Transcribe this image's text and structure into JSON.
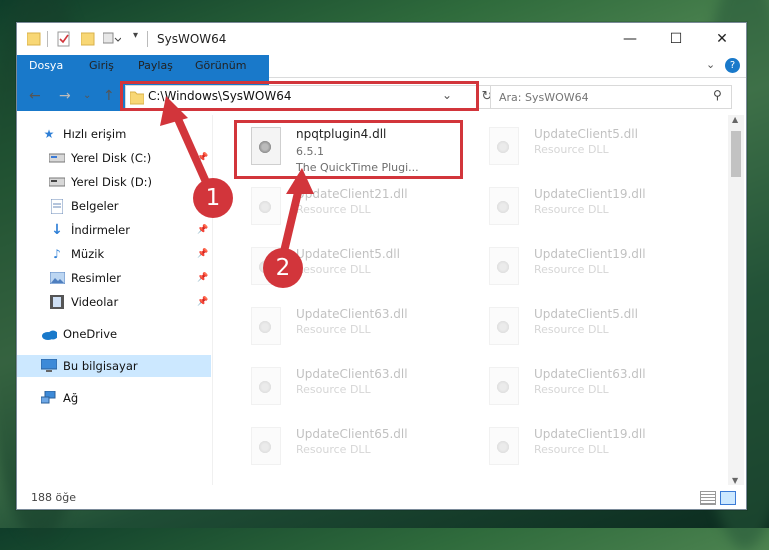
{
  "window": {
    "title": "SysWOW64",
    "minimize": "—",
    "maximize": "☐",
    "close": "✕"
  },
  "ribbon": {
    "tabs": [
      "Dosya",
      "Giriş",
      "Paylaş",
      "Görünüm"
    ],
    "expand_icon": "chevron-down-icon",
    "help": "?"
  },
  "address": {
    "path": "C:\\Windows\\SysWOW64",
    "search_placeholder": "Ara: SysWOW64"
  },
  "sidebar": {
    "items": [
      {
        "label": "Hızlı erişim",
        "icon": "star-icon"
      },
      {
        "label": "Yerel Disk (C:)",
        "icon": "drive-icon"
      },
      {
        "label": "Yerel Disk (D:)",
        "icon": "drive-icon"
      },
      {
        "label": "Belgeler",
        "icon": "document-icon"
      },
      {
        "label": "İndirmeler",
        "icon": "download-icon"
      },
      {
        "label": "Müzik",
        "icon": "music-icon"
      },
      {
        "label": "Resimler",
        "icon": "pictures-icon"
      },
      {
        "label": "Videolar",
        "icon": "video-icon"
      },
      {
        "label": "OneDrive",
        "icon": "cloud-icon"
      },
      {
        "label": "Bu bilgisayar",
        "icon": "computer-icon"
      },
      {
        "label": "Ağ",
        "icon": "network-icon"
      }
    ]
  },
  "files": [
    {
      "name": "npqtplugin4.dll",
      "line1": "6.5.1",
      "line2": "The QuickTime Plugi..."
    },
    {
      "name": "UpdateClient5.dll",
      "line1": "Resource DLL"
    },
    {
      "name": "UpdateClient21.dll",
      "line1": "Resource DLL"
    },
    {
      "name": "UpdateClient19.dll",
      "line1": "Resource DLL"
    },
    {
      "name": "UpdateClient5.dll",
      "line1": "Resource DLL"
    },
    {
      "name": "UpdateClient19.dll",
      "line1": "Resource DLL"
    },
    {
      "name": "UpdateClient63.dll",
      "line1": "Resource DLL"
    },
    {
      "name": "UpdateClient5.dll",
      "line1": "Resource DLL"
    },
    {
      "name": "UpdateClient63.dll",
      "line1": "Resource DLL"
    },
    {
      "name": "UpdateClient63.dll",
      "line1": "Resource DLL"
    },
    {
      "name": "UpdateClient65.dll",
      "line1": "Resource DLL"
    },
    {
      "name": "UpdateClient19.dll",
      "line1": "Resource DLL"
    }
  ],
  "status": {
    "count": "188 öğe"
  },
  "annotations": {
    "badge1": "1",
    "badge2": "2",
    "color": "#d2353b"
  }
}
